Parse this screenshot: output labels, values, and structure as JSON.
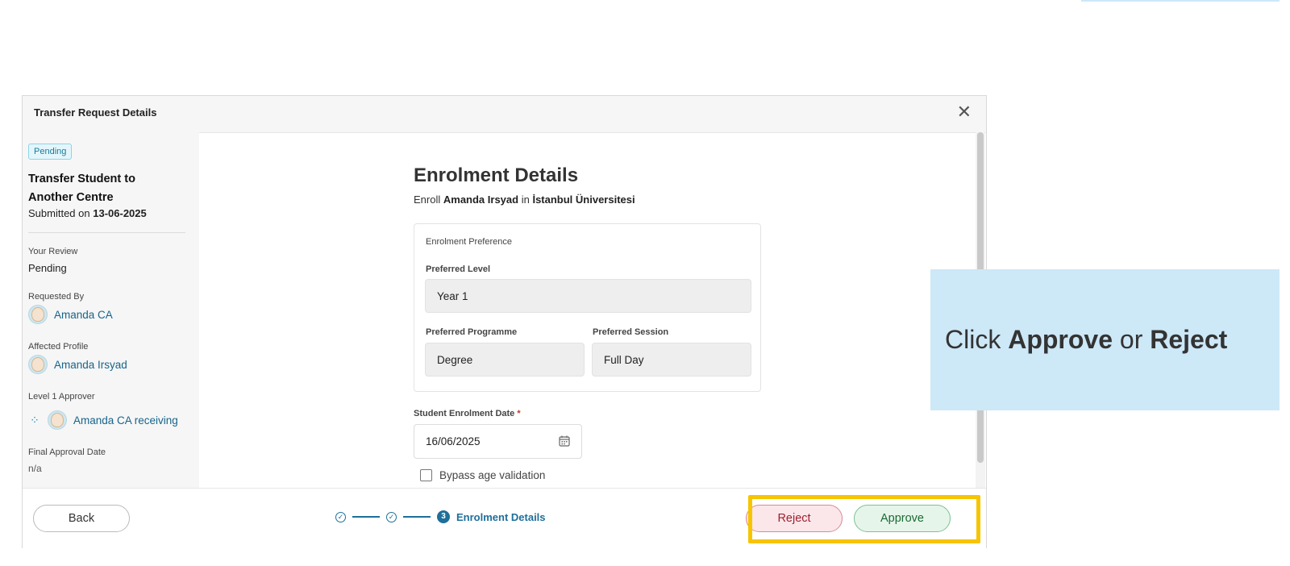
{
  "modal": {
    "title": "Transfer Request Details",
    "close_icon": "close-icon"
  },
  "sidebar": {
    "status_badge": "Pending",
    "request_title": "Transfer Student to Another Centre",
    "submitted_prefix": "Submitted on",
    "submitted_date": "13-06-2025",
    "your_review_label": "Your Review",
    "your_review_value": "Pending",
    "requested_by_label": "Requested By",
    "requested_by_name": "Amanda CA",
    "affected_profile_label": "Affected Profile",
    "affected_profile_name": "Amanda Irsyad",
    "level1_approver_label": "Level 1 Approver",
    "level1_approver_name": "Amanda CA receiving",
    "final_approval_label": "Final Approval Date",
    "final_approval_value": "n/a"
  },
  "content": {
    "title": "Enrolment Details",
    "subtitle_prefix": "Enroll",
    "student_name": "Amanda Irsyad",
    "subtitle_mid": "in",
    "centre_name": "İstanbul Üniversitesi",
    "preference_section_label": "Enrolment Preference",
    "preferred_level_label": "Preferred Level",
    "preferred_level_value": "Year 1",
    "preferred_programme_label": "Preferred Programme",
    "preferred_programme_value": "Degree",
    "preferred_session_label": "Preferred Session",
    "preferred_session_value": "Full Day",
    "enrolment_date_label": "Student Enrolment Date",
    "enrolment_date_required": "*",
    "enrolment_date_value": "16/06/2025",
    "bypass_label": "Bypass age validation",
    "bypass_checked": false
  },
  "footer": {
    "back_label": "Back",
    "step_current_number": "3",
    "step_current_label": "Enrolment Details",
    "reject_label": "Reject",
    "approve_label": "Approve"
  },
  "callout": {
    "prefix": "Click",
    "approve": "Approve",
    "mid": "or",
    "reject": "Reject"
  },
  "colors": {
    "accent": "#1e6f9a",
    "highlight": "#f7c400",
    "callout_bg": "#cde8f7",
    "reject_bg": "#fbe7ea",
    "approve_bg": "#e6f5ea"
  }
}
